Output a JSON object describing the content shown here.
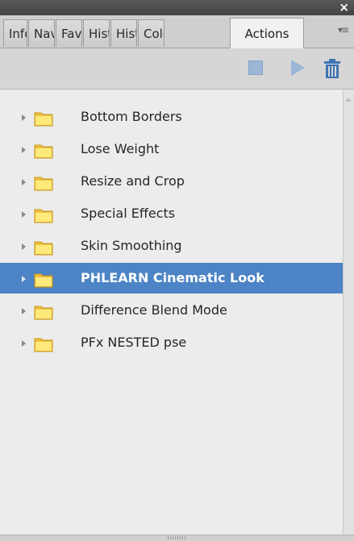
{
  "panel": {
    "close_symbol": "×",
    "menu_icon": "▾≡"
  },
  "tabs": [
    {
      "label": "Info",
      "active": false
    },
    {
      "label": "Navigator",
      "active": false
    },
    {
      "label": "Favorites",
      "active": false
    },
    {
      "label": "History",
      "active": false
    },
    {
      "label": "Histogram",
      "active": false
    },
    {
      "label": "Color",
      "active": false
    },
    {
      "label": "Actions",
      "active": true
    }
  ],
  "toolbar": {
    "stop_icon": "stop-icon",
    "play_icon": "play-icon",
    "delete_icon": "trash-icon"
  },
  "actions": [
    {
      "label": "Bottom Borders",
      "selected": false
    },
    {
      "label": "Lose Weight",
      "selected": false
    },
    {
      "label": "Resize and Crop",
      "selected": false
    },
    {
      "label": "Special Effects",
      "selected": false
    },
    {
      "label": "Skin Smoothing",
      "selected": false
    },
    {
      "label": "PHLEARN Cinematic Look",
      "selected": true
    },
    {
      "label": "Difference Blend Mode",
      "selected": false
    },
    {
      "label": "PFx NESTED pse",
      "selected": false
    }
  ],
  "colors": {
    "selection": "#4c84c5",
    "folder_fill": "#ffe97a",
    "icon_blue": "#9cb6d6",
    "trash_blue": "#3f73b3"
  }
}
